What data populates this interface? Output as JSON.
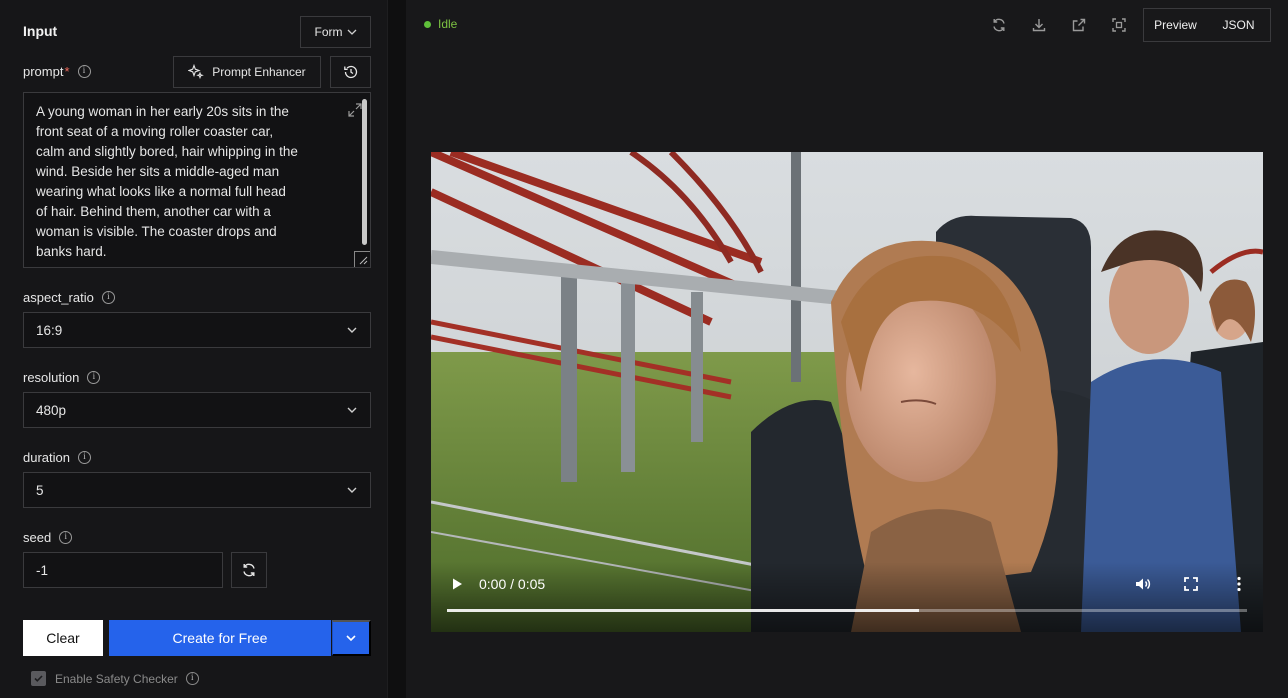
{
  "left_panel": {
    "title": "Input",
    "mode_button": "Form",
    "prompt": {
      "label": "prompt",
      "required_mark": "*",
      "enhancer_label": "Prompt Enhancer",
      "value": "A young woman in her early 20s sits in the\nfront seat of a moving roller coaster car,\ncalm and slightly bored, hair whipping in the\nwind. Beside her sits a middle-aged man\nwearing what looks like a normal full head\nof hair. Behind them, another car with a\nwoman is visible. The coaster drops and\nbanks hard."
    },
    "aspect_ratio": {
      "label": "aspect_ratio",
      "value": "16:9"
    },
    "resolution": {
      "label": "resolution",
      "value": "480p"
    },
    "duration": {
      "label": "duration",
      "value": "5"
    },
    "seed": {
      "label": "seed",
      "value": "-1"
    },
    "clear_label": "Clear",
    "create_label": "Create for Free",
    "safety_label": "Enable Safety Checker",
    "safety_checked": true
  },
  "right_panel": {
    "status": "Idle",
    "status_color": "#5fbf3a",
    "toolbar_icons": [
      "refresh-icon",
      "download-icon",
      "external-link-icon",
      "screenshot-icon"
    ],
    "view_toggle": {
      "preview": "Preview",
      "json": "JSON"
    },
    "video": {
      "current_time": "0:00",
      "separator": "/",
      "duration": "0:05",
      "progress_fraction": 0.59
    }
  },
  "colors": {
    "accent": "#2563eb",
    "panel": "#161618",
    "background": "#18181a"
  }
}
